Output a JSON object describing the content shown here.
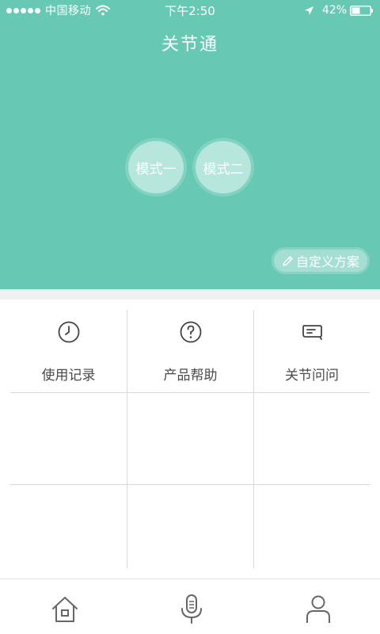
{
  "status_bar": {
    "carrier": "中国移动",
    "time": "下午2:50",
    "battery": "42%"
  },
  "header": {
    "title": "关节通"
  },
  "modes": [
    {
      "label": "模式一"
    },
    {
      "label": "模式二"
    }
  ],
  "custom_plan": {
    "label": "自定义方案",
    "icon": "pencil-icon"
  },
  "grid": {
    "items": [
      {
        "label": "使用记录",
        "icon": "clock-icon"
      },
      {
        "label": "产品帮助",
        "icon": "question-icon"
      },
      {
        "label": "关节问问",
        "icon": "chat-icon"
      }
    ]
  },
  "tabbar": {
    "tabs": [
      {
        "icon": "home-icon"
      },
      {
        "icon": "microphone-icon"
      },
      {
        "icon": "user-icon"
      }
    ]
  },
  "colors": {
    "accent": "#67c9b3",
    "mode_fill": "#b7e6dd",
    "divider": "#d9d9d9"
  }
}
